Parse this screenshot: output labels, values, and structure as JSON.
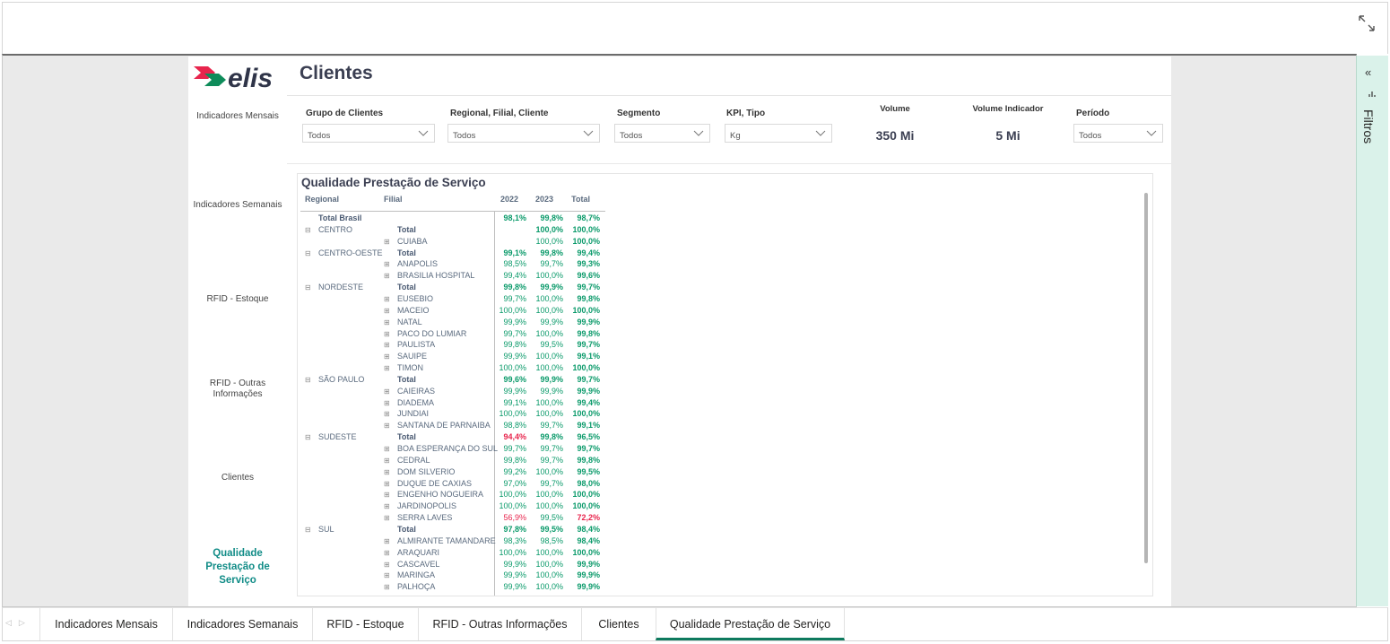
{
  "page": {
    "title": "Clientes"
  },
  "nav": {
    "items": [
      "Indicadores Mensais",
      "Indicadores Semanais",
      "RFID - Estoque",
      "RFID - Outras Informações",
      "Clientes",
      "Qualidade Prestação de Serviço"
    ]
  },
  "filters": {
    "grupo": {
      "label": "Grupo de Clientes",
      "value": "Todos"
    },
    "regional": {
      "label": "Regional, Filial, Cliente",
      "value": "Todos"
    },
    "segmento": {
      "label": "Segmento",
      "value": "Todos"
    },
    "kpi": {
      "label": "KPI, Tipo",
      "value": "Kg"
    },
    "periodo": {
      "label": "Período",
      "value": "Todos"
    }
  },
  "kpis": {
    "volume": {
      "label": "Volume",
      "value": "350 Mi"
    },
    "volume_indicador": {
      "label": "Volume Indicador",
      "value": "5 Mi"
    }
  },
  "matrix": {
    "title": "Qualidade Prestação de Serviço",
    "headers": {
      "regional": "Regional",
      "filial": "Filial",
      "y2022": "2022",
      "y2023": "2023",
      "total": "Total"
    },
    "rows": [
      {
        "reg": "Total Brasil",
        "fil": "",
        "a": "98,1%",
        "b": "99,8%",
        "t": "98,7%",
        "type": "grand"
      },
      {
        "reg": "CENTRO",
        "fil": "Total",
        "a": "",
        "b": "100,0%",
        "t": "100,0%",
        "type": "regtotal"
      },
      {
        "reg": "",
        "fil": "CUIABA",
        "a": "",
        "b": "100,0%",
        "t": "100,0%",
        "type": "fil"
      },
      {
        "reg": "CENTRO-OESTE",
        "fil": "Total",
        "a": "99,1%",
        "b": "99,8%",
        "t": "99,4%",
        "type": "regtotal"
      },
      {
        "reg": "",
        "fil": "ANAPOLIS",
        "a": "98,5%",
        "b": "99,7%",
        "t": "99,3%",
        "type": "fil"
      },
      {
        "reg": "",
        "fil": "BRASILIA HOSPITAL",
        "a": "99,4%",
        "b": "100,0%",
        "t": "99,6%",
        "type": "fil"
      },
      {
        "reg": "NORDESTE",
        "fil": "Total",
        "a": "99,8%",
        "b": "99,9%",
        "t": "99,7%",
        "type": "regtotal"
      },
      {
        "reg": "",
        "fil": "EUSEBIO",
        "a": "99,7%",
        "b": "100,0%",
        "t": "99,8%",
        "type": "fil"
      },
      {
        "reg": "",
        "fil": "MACEIO",
        "a": "100,0%",
        "b": "100,0%",
        "t": "100,0%",
        "type": "fil"
      },
      {
        "reg": "",
        "fil": "NATAL",
        "a": "99,9%",
        "b": "99,9%",
        "t": "99,9%",
        "type": "fil"
      },
      {
        "reg": "",
        "fil": "PACO DO LUMIAR",
        "a": "99,7%",
        "b": "100,0%",
        "t": "99,8%",
        "type": "fil"
      },
      {
        "reg": "",
        "fil": "PAULISTA",
        "a": "99,8%",
        "b": "99,5%",
        "t": "99,7%",
        "type": "fil"
      },
      {
        "reg": "",
        "fil": "SAUIPE",
        "a": "99,9%",
        "b": "100,0%",
        "t": "99,1%",
        "type": "fil"
      },
      {
        "reg": "",
        "fil": "TIMON",
        "a": "100,0%",
        "b": "100,0%",
        "t": "100,0%",
        "type": "fil"
      },
      {
        "reg": "SÃO PAULO",
        "fil": "Total",
        "a": "99,6%",
        "b": "99,9%",
        "t": "99,7%",
        "type": "regtotal"
      },
      {
        "reg": "",
        "fil": "CAIEIRAS",
        "a": "99,9%",
        "b": "99,9%",
        "t": "99,9%",
        "type": "fil"
      },
      {
        "reg": "",
        "fil": "DIADEMA",
        "a": "99,1%",
        "b": "100,0%",
        "t": "99,4%",
        "type": "fil"
      },
      {
        "reg": "",
        "fil": "JUNDIAI",
        "a": "100,0%",
        "b": "100,0%",
        "t": "100,0%",
        "type": "fil"
      },
      {
        "reg": "",
        "fil": "SANTANA DE PARNAIBA",
        "a": "98,8%",
        "b": "99,7%",
        "t": "99,1%",
        "type": "fil"
      },
      {
        "reg": "SUDESTE",
        "fil": "Total",
        "a": "94,4%",
        "b": "99,8%",
        "t": "96,5%",
        "type": "regtotal",
        "redA": true
      },
      {
        "reg": "",
        "fil": "BOA ESPERANÇA DO SUL",
        "a": "99,7%",
        "b": "99,7%",
        "t": "99,7%",
        "type": "fil"
      },
      {
        "reg": "",
        "fil": "CEDRAL",
        "a": "99,8%",
        "b": "99,7%",
        "t": "99,8%",
        "type": "fil"
      },
      {
        "reg": "",
        "fil": "DOM SILVERIO",
        "a": "99,2%",
        "b": "100,0%",
        "t": "99,5%",
        "type": "fil"
      },
      {
        "reg": "",
        "fil": "DUQUE DE CAXIAS",
        "a": "97,0%",
        "b": "99,7%",
        "t": "98,0%",
        "type": "fil"
      },
      {
        "reg": "",
        "fil": "ENGENHO NOGUEIRA",
        "a": "100,0%",
        "b": "100,0%",
        "t": "100,0%",
        "type": "fil"
      },
      {
        "reg": "",
        "fil": "JARDINOPOLIS",
        "a": "100,0%",
        "b": "100,0%",
        "t": "100,0%",
        "type": "fil"
      },
      {
        "reg": "",
        "fil": "SERRA LAVES",
        "a": "56,9%",
        "b": "99,5%",
        "t": "72,2%",
        "type": "fil",
        "redA": true,
        "redT": true
      },
      {
        "reg": "SUL",
        "fil": "Total",
        "a": "97,8%",
        "b": "99,5%",
        "t": "98,4%",
        "type": "regtotal"
      },
      {
        "reg": "",
        "fil": "ALMIRANTE TAMANDARE",
        "a": "98,3%",
        "b": "98,5%",
        "t": "98,4%",
        "type": "fil"
      },
      {
        "reg": "",
        "fil": "ARAQUARI",
        "a": "100,0%",
        "b": "100,0%",
        "t": "100,0%",
        "type": "fil"
      },
      {
        "reg": "",
        "fil": "CASCAVEL",
        "a": "99,9%",
        "b": "100,0%",
        "t": "99,9%",
        "type": "fil"
      },
      {
        "reg": "",
        "fil": "MARINGA",
        "a": "99,9%",
        "b": "100,0%",
        "t": "99,9%",
        "type": "fil"
      },
      {
        "reg": "",
        "fil": "PALHOÇA",
        "a": "99,9%",
        "b": "100,0%",
        "t": "99,9%",
        "type": "fil"
      }
    ]
  },
  "side_pane": {
    "label": "Filtros",
    "collapse_icon": "double-chevron-left-icon"
  },
  "tabs": [
    "Indicadores Mensais",
    "Indicadores Semanais",
    "RFID - Estoque",
    "RFID - Outras Informações",
    "Clientes",
    "Qualidade Prestação de Serviço"
  ],
  "active_tab": "Qualidade Prestação de Serviço",
  "colors": {
    "accent": "#118c87",
    "good": "#0a9a6a",
    "bad": "#e8254d",
    "pane": "#daf2ea",
    "tab_active": "#0e7a5e"
  }
}
